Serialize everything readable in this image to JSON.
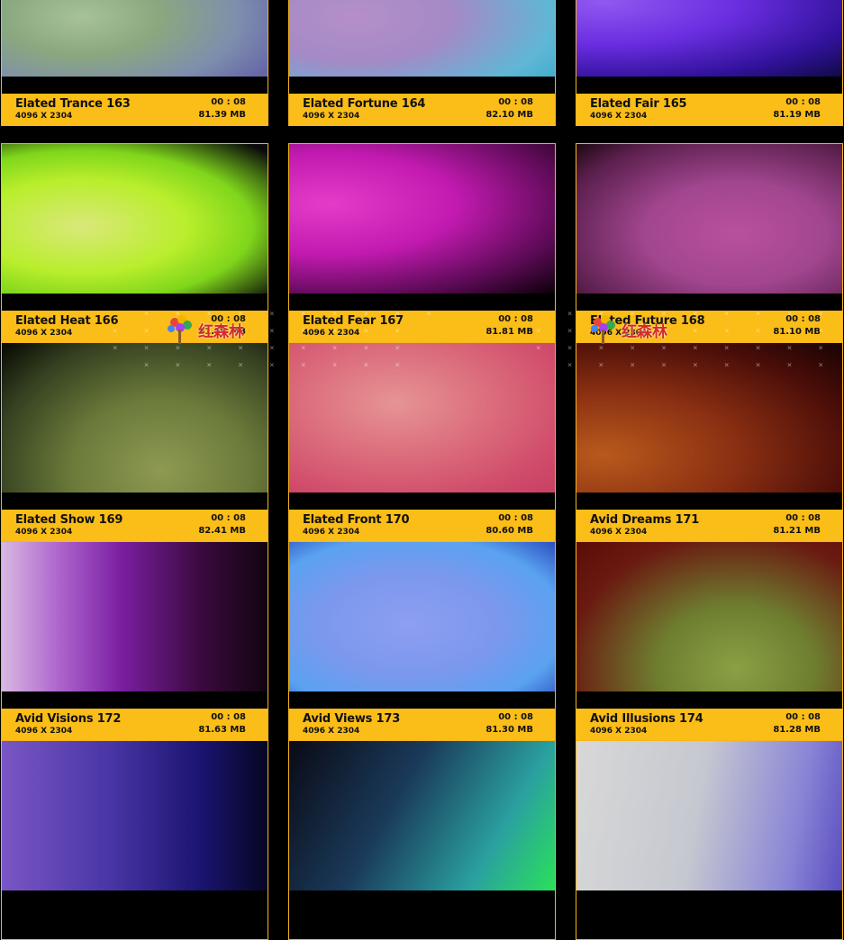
{
  "cards": [
    {
      "name": "Elated Trance 163",
      "resolution": "4096 X 2304",
      "duration": "00 : 08",
      "size": "81.39 MB",
      "gradient": "radial-gradient(ellipse at 30% 60%, #a7c29a 0%, #8aa87f 30%, #7d8eae 60%, #5446a0 100%)"
    },
    {
      "name": "Elated Fortune 164",
      "resolution": "4096 X 2304",
      "duration": "00 : 08",
      "size": "82.10 MB",
      "gradient": "radial-gradient(ellipse at 25% 60%, #b58fc7 0%, #a48ac6 35%, #5fb7d6 70%, #2aa3c8 100%)"
    },
    {
      "name": "Elated Fair 165",
      "resolution": "4096 X 2304",
      "duration": "00 : 08",
      "size": "81.19 MB",
      "gradient": "radial-gradient(ellipse at 10% 50%, #9158f0 0%, #6a2ee0 40%, #32129c 75%, #0f0a44 100%)"
    },
    {
      "name": "Elated Heat 166",
      "resolution": "4096 X 2304",
      "duration": "00 : 08",
      "size": "81.56 MB",
      "gradient": "radial-gradient(ellipse at 30% 55%, #d9e87a 0%, #b9ee2c 40%, #7fd61b 65%, #0a0a0a 95%)"
    },
    {
      "name": "Elated Fear 167",
      "resolution": "4096 X 2304",
      "duration": "00 : 08",
      "size": "81.81 MB",
      "gradient": "radial-gradient(ellipse at 15% 40%, #e53cc8 0%, #c21ab0 40%, #5a0a54 75%, #0b0008 100%)"
    },
    {
      "name": "Elated Future 168",
      "resolution": "4096 X 2304",
      "duration": "00 : 08",
      "size": "81.10 MB",
      "gradient": "radial-gradient(ellipse at 60% 60%, #b9509d 0%, #a24690 40%, #5a1f4c 80%, #1c0812 100%)"
    },
    {
      "name": "Elated Show 169",
      "resolution": "4096 X 2304",
      "duration": "00 : 08",
      "size": "82.41 MB",
      "gradient": "radial-gradient(ellipse at 60% 85%, #8e9a52 0%, #6b7a3a 40%, #344020 75%, #050700 100%)"
    },
    {
      "name": "Elated Front 170",
      "resolution": "4096 X 2304",
      "duration": "00 : 08",
      "size": "80.60 MB",
      "gradient": "radial-gradient(ellipse at 40% 40%, #e69494 0%, #dc6f7d 40%, #d04a6a 80%, #c84064 100%)"
    },
    {
      "name": "Avid Dreams 171",
      "resolution": "4096 X 2304",
      "duration": "00 : 08",
      "size": "81.21 MB",
      "gradient": "radial-gradient(ellipse at 10% 75%, #b85a1c 0%, #8a2f12 40%, #4a0d08 75%, #160303 100%)"
    },
    {
      "name": "Avid Visions 172",
      "resolution": "4096 X 2304",
      "duration": "00 : 08",
      "size": "81.63 MB",
      "gradient": "linear-gradient(90deg, #d9b8e0 0%, #b06ad0 20%, #7a1ea0 45%, #3a0a3e 75%, #120410 100%)"
    },
    {
      "name": "Avid Views 173",
      "resolution": "4096 X 2304",
      "duration": "00 : 08",
      "size": "81.30 MB",
      "gradient": "radial-gradient(ellipse at 45% 55%, #8e9ef0 0%, #7a98ee 45%, #5aa2f0 75%, #2a4fc0 100%)"
    },
    {
      "name": "Avid Illusions 174",
      "resolution": "4096 X 2304",
      "duration": "00 : 08",
      "size": "81.28 MB",
      "gradient": "radial-gradient(ellipse at 60% 85%, #8aa044 0%, #6e7e30 35%, #6a1a10 75%, #5a0c06 100%)"
    },
    {
      "name": "",
      "resolution": "",
      "duration": "",
      "size": "",
      "gradient": "linear-gradient(90deg, #7a56c4 0%, #4a36a6 40%, #1a1470 75%, #060622 100%)"
    },
    {
      "name": "",
      "resolution": "",
      "duration": "",
      "size": "",
      "gradient": "linear-gradient(120deg, #0a0a14 0%, #1a3a5a 40%, #2aa0a0 75%, #2ae05a 100%)"
    },
    {
      "name": "",
      "resolution": "",
      "duration": "",
      "size": "",
      "gradient": "linear-gradient(100deg, #d8d8d8 0%, #c6c8d0 45%, #8a86d6 80%, #5a4ec0 100%)"
    }
  ],
  "watermark": {
    "text": "红森林",
    "icon": "tree-logo-icon"
  }
}
